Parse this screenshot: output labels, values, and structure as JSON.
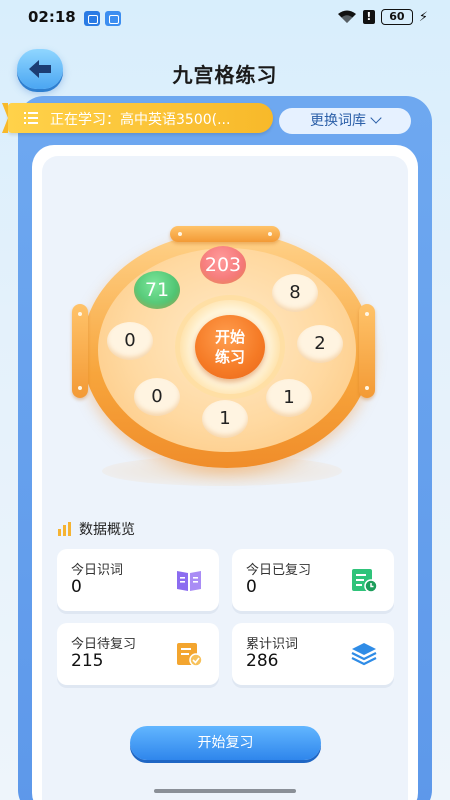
{
  "status_bar": {
    "time": "02:18",
    "battery": "60"
  },
  "header": {
    "title": "九宫格练习"
  },
  "study": {
    "current_text": "正在学习：高中英语3500(...",
    "change_label": "更换词库"
  },
  "wheel": {
    "center_label_line1": "开始",
    "center_label_line2": "练习",
    "values": [
      "203",
      "8",
      "2",
      "1",
      "1",
      "0",
      "0",
      "71"
    ]
  },
  "overview": {
    "title": "数据概览",
    "cards": [
      {
        "label": "今日识词",
        "value": "0",
        "icon": "book-icon",
        "color": "#8b6cf0"
      },
      {
        "label": "今日已复习",
        "value": "0",
        "icon": "checklist-clock-icon",
        "color": "#2fc37a"
      },
      {
        "label": "今日待复习",
        "value": "215",
        "icon": "document-check-icon",
        "color": "#f3a52f"
      },
      {
        "label": "累计识词",
        "value": "286",
        "icon": "layers-icon",
        "color": "#2f8ce6"
      }
    ]
  },
  "actions": {
    "review_label": "开始复习"
  },
  "colors": {
    "accent": "#2f86ec",
    "wheel": "#f7a53c",
    "banner": "#ffd24a"
  }
}
